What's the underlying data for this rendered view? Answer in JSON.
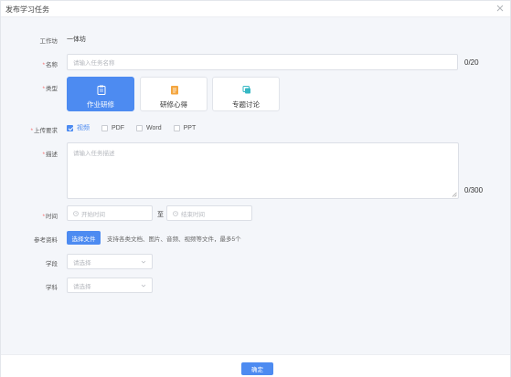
{
  "dialog": {
    "title": "发布学习任务"
  },
  "form": {
    "studio": {
      "label": "工作坊",
      "value": "一体坊"
    },
    "name": {
      "label": "名称",
      "placeholder": "请输入任务名称",
      "counter": "0/20"
    },
    "type": {
      "label": "类型",
      "options": [
        {
          "label": "作业研修",
          "icon": "clipboard-icon",
          "selected": true
        },
        {
          "label": "研修心得",
          "icon": "notes-icon",
          "selected": false
        },
        {
          "label": "专题讨论",
          "icon": "discussion-icon",
          "selected": false
        }
      ]
    },
    "upload_requirement": {
      "label": "上传要求",
      "options": [
        {
          "label": "视频",
          "checked": true
        },
        {
          "label": "PDF",
          "checked": false
        },
        {
          "label": "Word",
          "checked": false
        },
        {
          "label": "PPT",
          "checked": false
        }
      ]
    },
    "description": {
      "label": "描述",
      "placeholder": "请输入任务描述",
      "counter": "0/300"
    },
    "time": {
      "label": "时间",
      "start_placeholder": "开始时间",
      "separator": "至",
      "end_placeholder": "结束时间"
    },
    "reference": {
      "label": "参考资料",
      "button": "选择文件",
      "hint": "支持各类文档、图片、音频、视频等文件，最多5个"
    },
    "school": {
      "label": "学段",
      "placeholder": "请选择"
    },
    "subject": {
      "label": "学科",
      "placeholder": "请选择"
    }
  },
  "footer": {
    "confirm": "确定"
  },
  "colors": {
    "primary": "#4d8bf1",
    "required": "#f56c6c",
    "background": "#f4f6fa"
  }
}
